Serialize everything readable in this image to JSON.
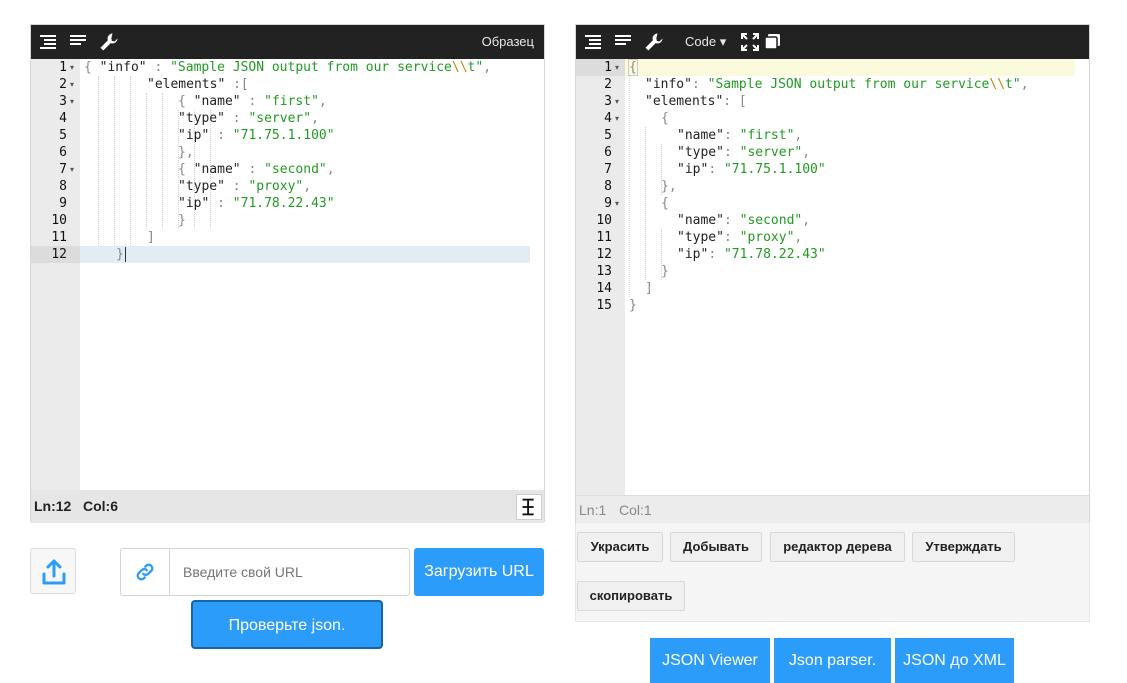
{
  "left_editor": {
    "toolbar": {
      "icons": [
        "format-icon",
        "compact-icon",
        "wrench-icon"
      ],
      "sample_label": "Образец"
    },
    "lines": [
      {
        "n": "1",
        "fold": true
      },
      {
        "n": "2",
        "fold": true
      },
      {
        "n": "3",
        "fold": true
      },
      {
        "n": "4",
        "fold": false
      },
      {
        "n": "5",
        "fold": false
      },
      {
        "n": "6",
        "fold": false
      },
      {
        "n": "7",
        "fold": true
      },
      {
        "n": "8",
        "fold": false
      },
      {
        "n": "9",
        "fold": false
      },
      {
        "n": "10",
        "fold": false
      },
      {
        "n": "11",
        "fold": false
      },
      {
        "n": "12",
        "fold": false
      }
    ],
    "code": {
      "l1_open": "{",
      "l1_key": "\"info\"",
      "l1_sep": " : ",
      "l1_val_a": "\"Sample JSON output from our service",
      "l1_val_esc": "\\\\",
      "l1_val_b": "t\"",
      "l1_comma": ",",
      "l2_key": "\"elements\"",
      "l2_sep": " :[",
      "l3_open": "{ ",
      "l3_key": "\"name\"",
      "l3_sep": " : ",
      "l3_val": "\"first\"",
      "l3_comma": ",",
      "l4_key": "\"type\"",
      "l4_sep": " : ",
      "l4_val": "\"server\"",
      "l4_comma": ",",
      "l5_key": "\"ip\"",
      "l5_sep": " : ",
      "l5_val": "\"71.75.1.100\"",
      "l6": "},",
      "l7_open": "{ ",
      "l7_key": "\"name\"",
      "l7_sep": " : ",
      "l7_val": "\"second\"",
      "l7_comma": ",",
      "l8_key": "\"type\"",
      "l8_sep": " : ",
      "l8_val": "\"proxy\"",
      "l8_comma": ",",
      "l9_key": "\"ip\"",
      "l9_sep": " : ",
      "l9_val": "\"71.78.22.43\"",
      "l10": "}",
      "l11": "]",
      "l12": "}"
    },
    "status": {
      "ln": "Ln:12",
      "col": "Col:6"
    }
  },
  "right_editor": {
    "toolbar": {
      "icons": [
        "format-icon",
        "compact-icon",
        "wrench-icon",
        "fullscreen-icon",
        "copy-window-icon"
      ],
      "mode_label": "Code ▾"
    },
    "lines": [
      {
        "n": "1",
        "fold": true
      },
      {
        "n": "2",
        "fold": false
      },
      {
        "n": "3",
        "fold": true
      },
      {
        "n": "4",
        "fold": true
      },
      {
        "n": "5",
        "fold": false
      },
      {
        "n": "6",
        "fold": false
      },
      {
        "n": "7",
        "fold": false
      },
      {
        "n": "8",
        "fold": false
      },
      {
        "n": "9",
        "fold": true
      },
      {
        "n": "10",
        "fold": false
      },
      {
        "n": "11",
        "fold": false
      },
      {
        "n": "12",
        "fold": false
      },
      {
        "n": "13",
        "fold": false
      },
      {
        "n": "14",
        "fold": false
      },
      {
        "n": "15",
        "fold": false
      }
    ],
    "code": {
      "l1": "{",
      "l2_key": "\"info\"",
      "l2_sep": ": ",
      "l2_val_a": "\"Sample JSON output from our service",
      "l2_val_esc": "\\\\",
      "l2_val_b": "t\"",
      "l2_comma": ",",
      "l3_key": "\"elements\"",
      "l3_sep": ": [",
      "l4": "{",
      "l5_key": "\"name\"",
      "l5_sep": ": ",
      "l5_val": "\"first\"",
      "l5_comma": ",",
      "l6_key": "\"type\"",
      "l6_sep": ": ",
      "l6_val": "\"server\"",
      "l6_comma": ",",
      "l7_key": "\"ip\"",
      "l7_sep": ": ",
      "l7_val": "\"71.75.1.100\"",
      "l8": "},",
      "l9": "{",
      "l10_key": "\"name\"",
      "l10_sep": ": ",
      "l10_val": "\"second\"",
      "l10_comma": ",",
      "l11_key": "\"type\"",
      "l11_sep": ": ",
      "l11_val": "\"proxy\"",
      "l11_comma": ",",
      "l12_key": "\"ip\"",
      "l12_sep": ": ",
      "l12_val": "\"71.78.22.43\"",
      "l13": "}",
      "l14": "]",
      "l15": "}"
    },
    "status": {
      "ln": "Ln:1",
      "col": "Col:1"
    },
    "actions": [
      "Украсить",
      "Добывать",
      "редактор дерева",
      "Утверждать",
      "скопировать"
    ]
  },
  "url_bar": {
    "placeholder": "Введите свой URL",
    "load_button": "Загрузить URL"
  },
  "validate_button": "Проверьте json.",
  "bottom_links": [
    "JSON Viewer",
    "Json parser.",
    "JSON до XML"
  ],
  "colors": {
    "toolbar_bg": "#222222",
    "accent_blue": "#2c9cfa",
    "string_green": "#219b22",
    "escape_orange": "#c5860a",
    "active_line_left": "#e2ecf5",
    "active_line_right": "#fbfadc"
  }
}
